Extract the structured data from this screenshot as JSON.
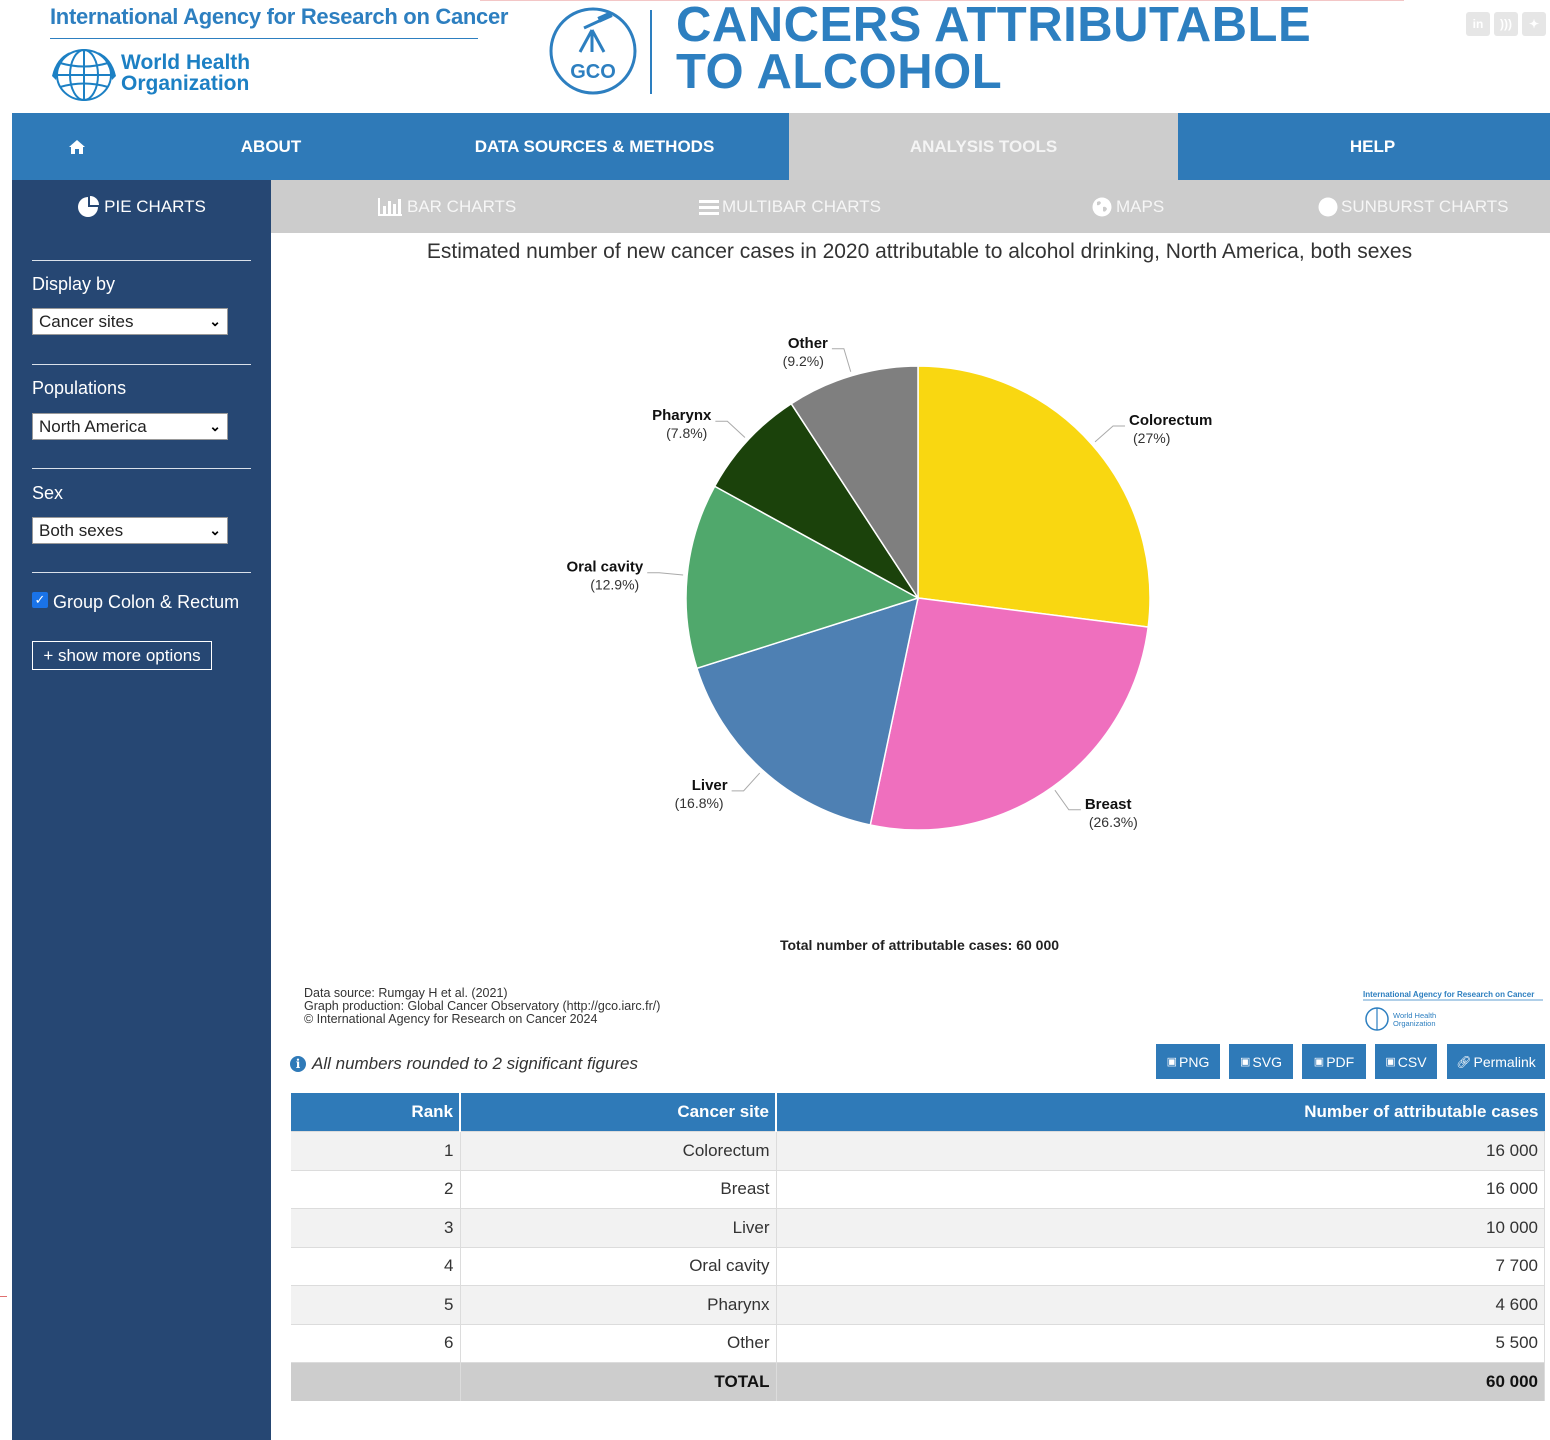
{
  "header": {
    "iarc_name": "International Agency for Research on Cancer",
    "who_name_line1": "World Health",
    "who_name_line2": "Organization",
    "gco_logo_text": "GCO",
    "title_line1": "CANCERS ATTRIBUTABLE",
    "title_line2": "TO ALCOHOL",
    "social_icons": [
      "linkedin-icon",
      "rss-icon",
      "twitter-icon"
    ]
  },
  "main_nav": {
    "home_icon": "home-icon",
    "items": [
      "ABOUT",
      "DATA SOURCES & METHODS",
      "ANALYSIS TOOLS",
      "HELP"
    ],
    "active": "ANALYSIS TOOLS"
  },
  "chart_tabs": [
    {
      "label": "PIE CHARTS",
      "icon": "pie-chart-icon",
      "active": true
    },
    {
      "label": "BAR CHARTS",
      "icon": "bar-chart-icon",
      "active": false
    },
    {
      "label": "MULTIBAR CHARTS",
      "icon": "bars-icon",
      "active": false
    },
    {
      "label": "MAPS",
      "icon": "globe-icon",
      "active": false
    },
    {
      "label": "SUNBURST CHARTS",
      "icon": "circle-icon",
      "active": false
    }
  ],
  "sidebar": {
    "display_by": {
      "label": "Display by",
      "value": "Cancer sites"
    },
    "populations": {
      "label": "Populations",
      "value": "North America"
    },
    "sex": {
      "label": "Sex",
      "value": "Both sexes"
    },
    "group_checkbox": {
      "label": "Group Colon & Rectum",
      "checked": true
    },
    "more_options": "+ show more options"
  },
  "chart_data": {
    "type": "pie",
    "title": "Estimated number of new cancer cases in 2020 attributable to alcohol drinking, North America, both sexes",
    "slices": [
      {
        "label": "Colorectum",
        "percent_label": "(27%)",
        "value": 27.0,
        "color": "#f9d711"
      },
      {
        "label": "Breast",
        "percent_label": "(26.3%)",
        "value": 26.3,
        "color": "#ef6fbe"
      },
      {
        "label": "Liver",
        "percent_label": "(16.8%)",
        "value": 16.8,
        "color": "#4e80b3"
      },
      {
        "label": "Oral cavity",
        "percent_label": "(12.9%)",
        "value": 12.9,
        "color": "#50a86c"
      },
      {
        "label": "Pharynx",
        "percent_label": "(7.8%)",
        "value": 7.8,
        "color": "#1b420b"
      },
      {
        "label": "Other",
        "percent_label": "(9.2%)",
        "value": 9.2,
        "color": "#7f7f7f"
      }
    ],
    "total_text": "Total number of attributable cases: 60 000"
  },
  "credits": {
    "line1": "Data source: Rumgay H et al. (2021)",
    "line2": "Graph production: Global Cancer Observatory (http://gco.iarc.fr/)",
    "line3": "© International Agency for Research on Cancer 2024"
  },
  "mini_logo": {
    "iarc": "International Agency for Research on Cancer",
    "who1": "World Health",
    "who2": "Organization"
  },
  "note": "All numbers rounded to 2 significant figures",
  "export_buttons": [
    "PNG",
    "SVG",
    "PDF",
    "CSV",
    "Permalink"
  ],
  "table": {
    "headers": [
      "Rank",
      "Cancer site",
      "Number of attributable cases"
    ],
    "rows": [
      [
        "1",
        "Colorectum",
        "16 000"
      ],
      [
        "2",
        "Breast",
        "16 000"
      ],
      [
        "3",
        "Liver",
        "10 000"
      ],
      [
        "4",
        "Oral cavity",
        "7 700"
      ],
      [
        "5",
        "Pharynx",
        "4 600"
      ],
      [
        "6",
        "Other",
        "5 500"
      ]
    ],
    "total": [
      "",
      "TOTAL",
      "60 000"
    ]
  }
}
